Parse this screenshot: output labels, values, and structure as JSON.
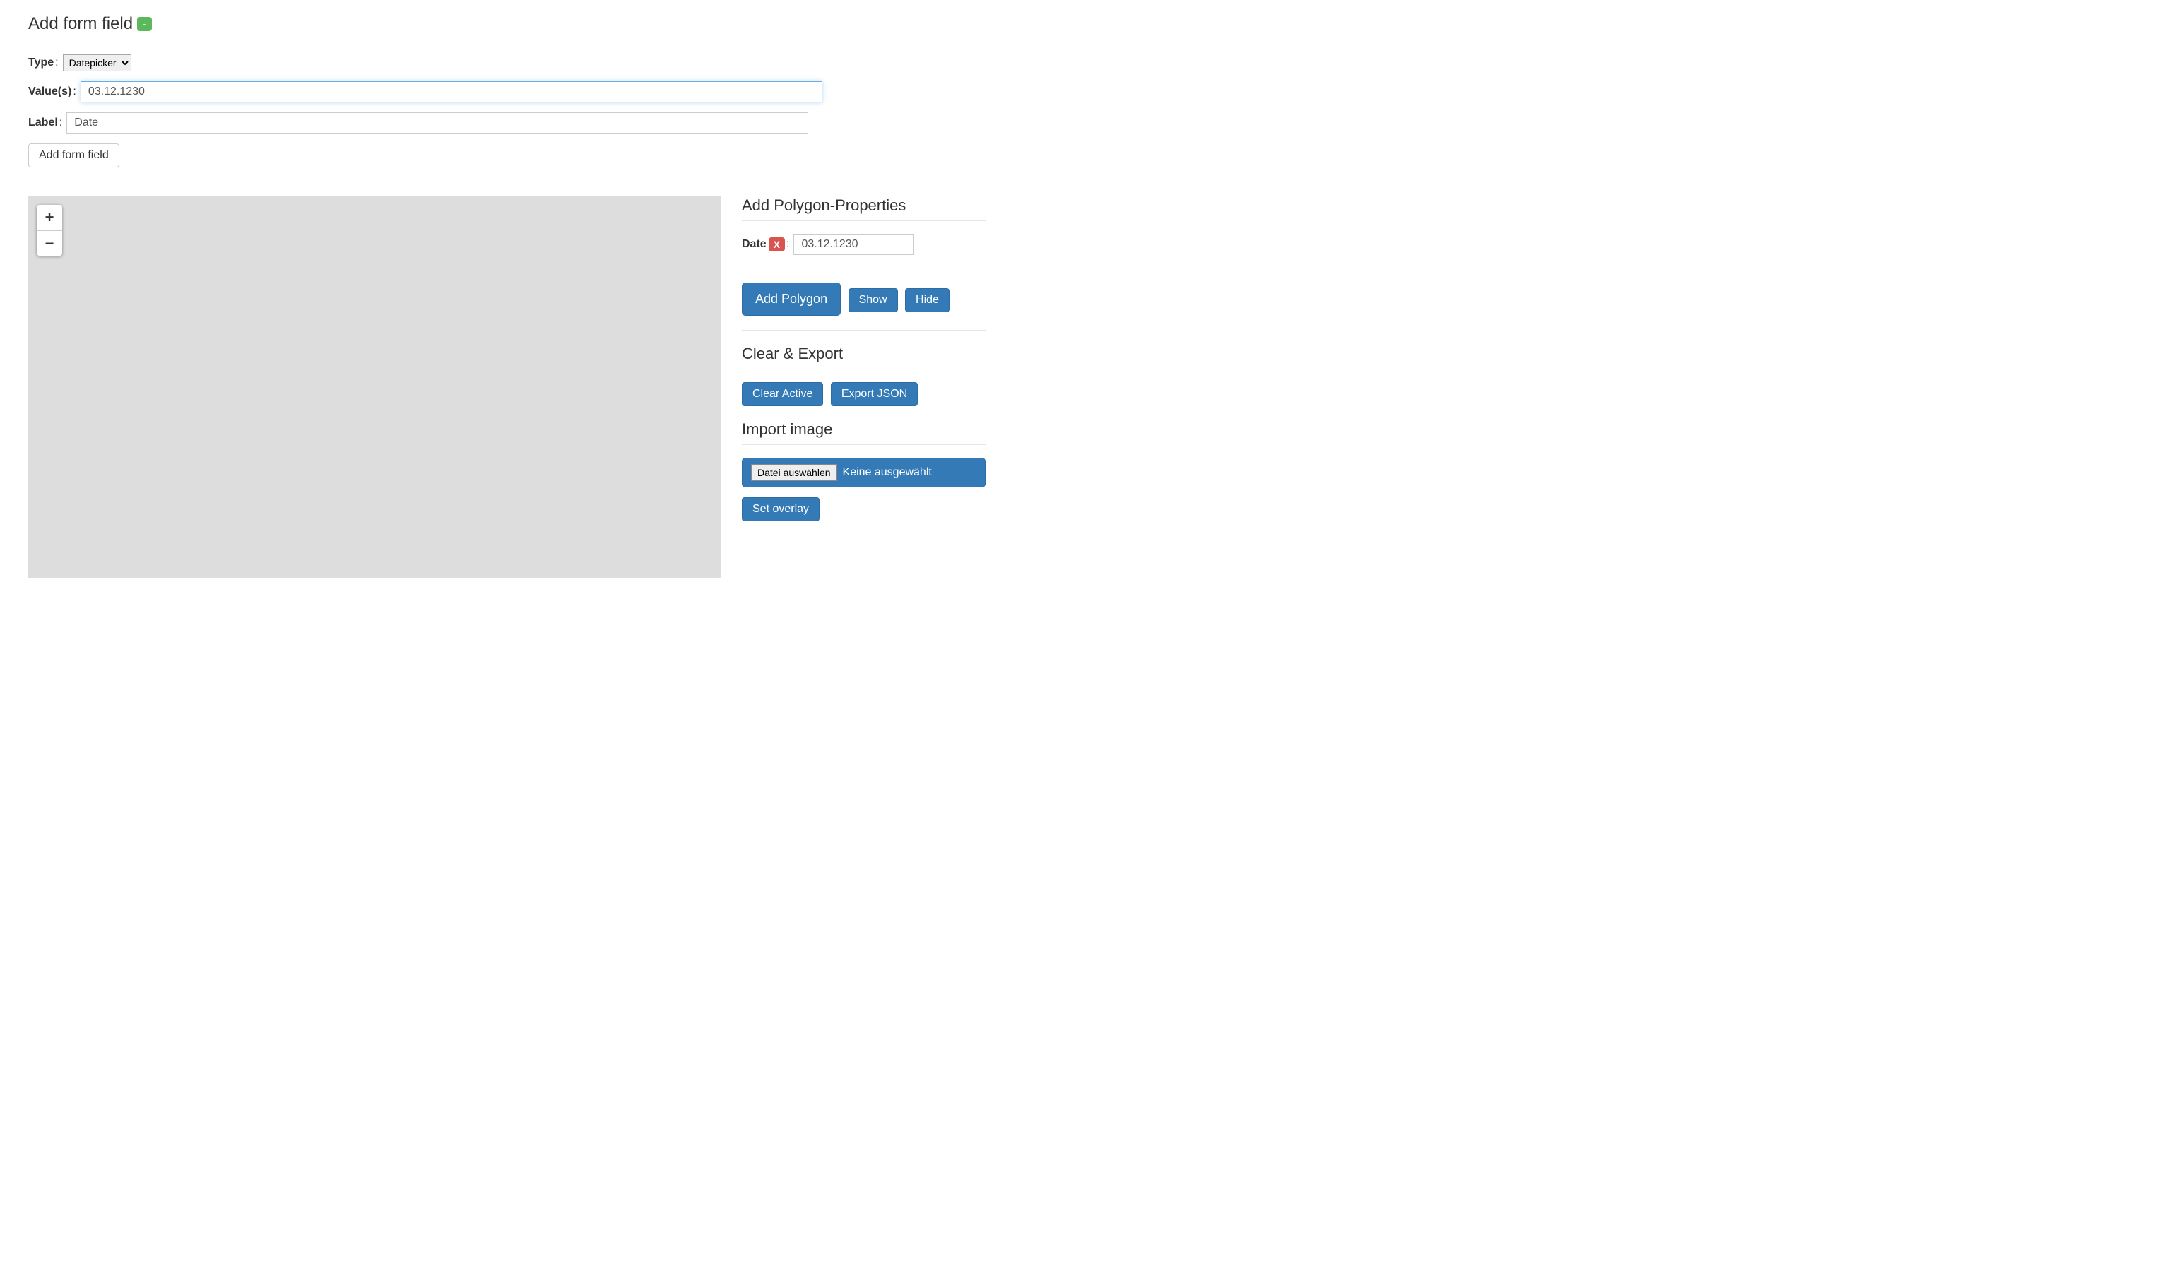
{
  "addForm": {
    "heading": "Add form field",
    "badge": "-",
    "typeLabel": "Type",
    "typeSelected": "Datepicker",
    "valuesLabel": "Value(s)",
    "valuesValue": "03.12.1230",
    "labelLabel": "Label",
    "labelValue": "Date",
    "addButton": "Add form field"
  },
  "polygon": {
    "heading": "Add Polygon-Properties",
    "propLabel": "Date",
    "removeBadge": "X",
    "propValue": "03.12.1230",
    "addBtn": "Add Polygon",
    "showBtn": "Show",
    "hideBtn": "Hide"
  },
  "clearExport": {
    "heading": "Clear & Export",
    "clearBtn": "Clear Active",
    "exportBtn": "Export JSON"
  },
  "importImage": {
    "heading": "Import image",
    "chooseFile": "Datei auswählen",
    "fileStatus": "Keine ausgewählt",
    "setOverlay": "Set overlay"
  },
  "map": {
    "zoomIn": "+",
    "zoomOut": "−"
  }
}
